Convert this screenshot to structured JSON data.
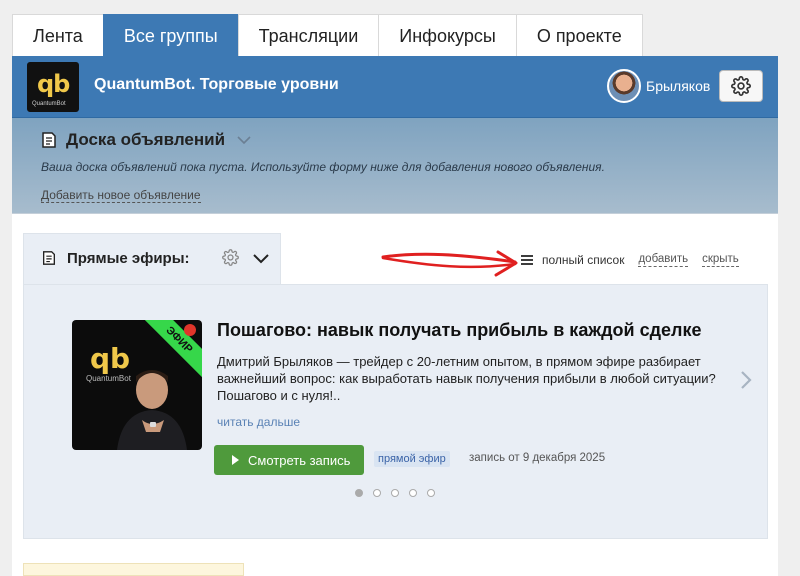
{
  "tabs": [
    {
      "label": "Лента",
      "active": false
    },
    {
      "label": "Все группы",
      "active": true
    },
    {
      "label": "Трансляции",
      "active": false
    },
    {
      "label": "Инфокурсы",
      "active": false
    },
    {
      "label": "О проекте",
      "active": false
    }
  ],
  "group": {
    "logo_text": "qb",
    "logo_subtext": "QuantumBot",
    "title": "QuantumBot. Торговые уровни",
    "user_name": "Брыляков",
    "settings_icon": "gear-icon"
  },
  "board": {
    "title": "Доска объявлений",
    "empty_text": "Ваша доска объявлений пока пуста. Используйте форму ниже для добавления нового объявления.",
    "add_link": "Добавить новое объявление"
  },
  "live": {
    "title": "Прямые эфиры:",
    "full_list": "полный список",
    "add": "добавить",
    "hide": "скрыть",
    "item": {
      "ribbon": "ЭФИР",
      "thumb_logo": "qb",
      "thumb_sub": "QuantumBot",
      "title": "Пошагово: навык получать прибыль в каждой сделке",
      "description": "Дмитрий Брыляков — трейдер с 20-летним опытом, в прямом эфире разбирает важнейший вопрос: как выработать навык получения прибыли в любой ситуации? Пошагово и с нуля!..",
      "read_more": "читать дальше",
      "watch_button": "Смотреть запись",
      "badge": "прямой эфир",
      "record_date": "запись от 9 декабря 2025"
    },
    "slides_total": 5,
    "slide_active": 1
  },
  "colors": {
    "accent": "#3d79b4",
    "live_green": "#36d74a",
    "button_green": "#4f9a3c",
    "annotation_red": "#e02020"
  }
}
